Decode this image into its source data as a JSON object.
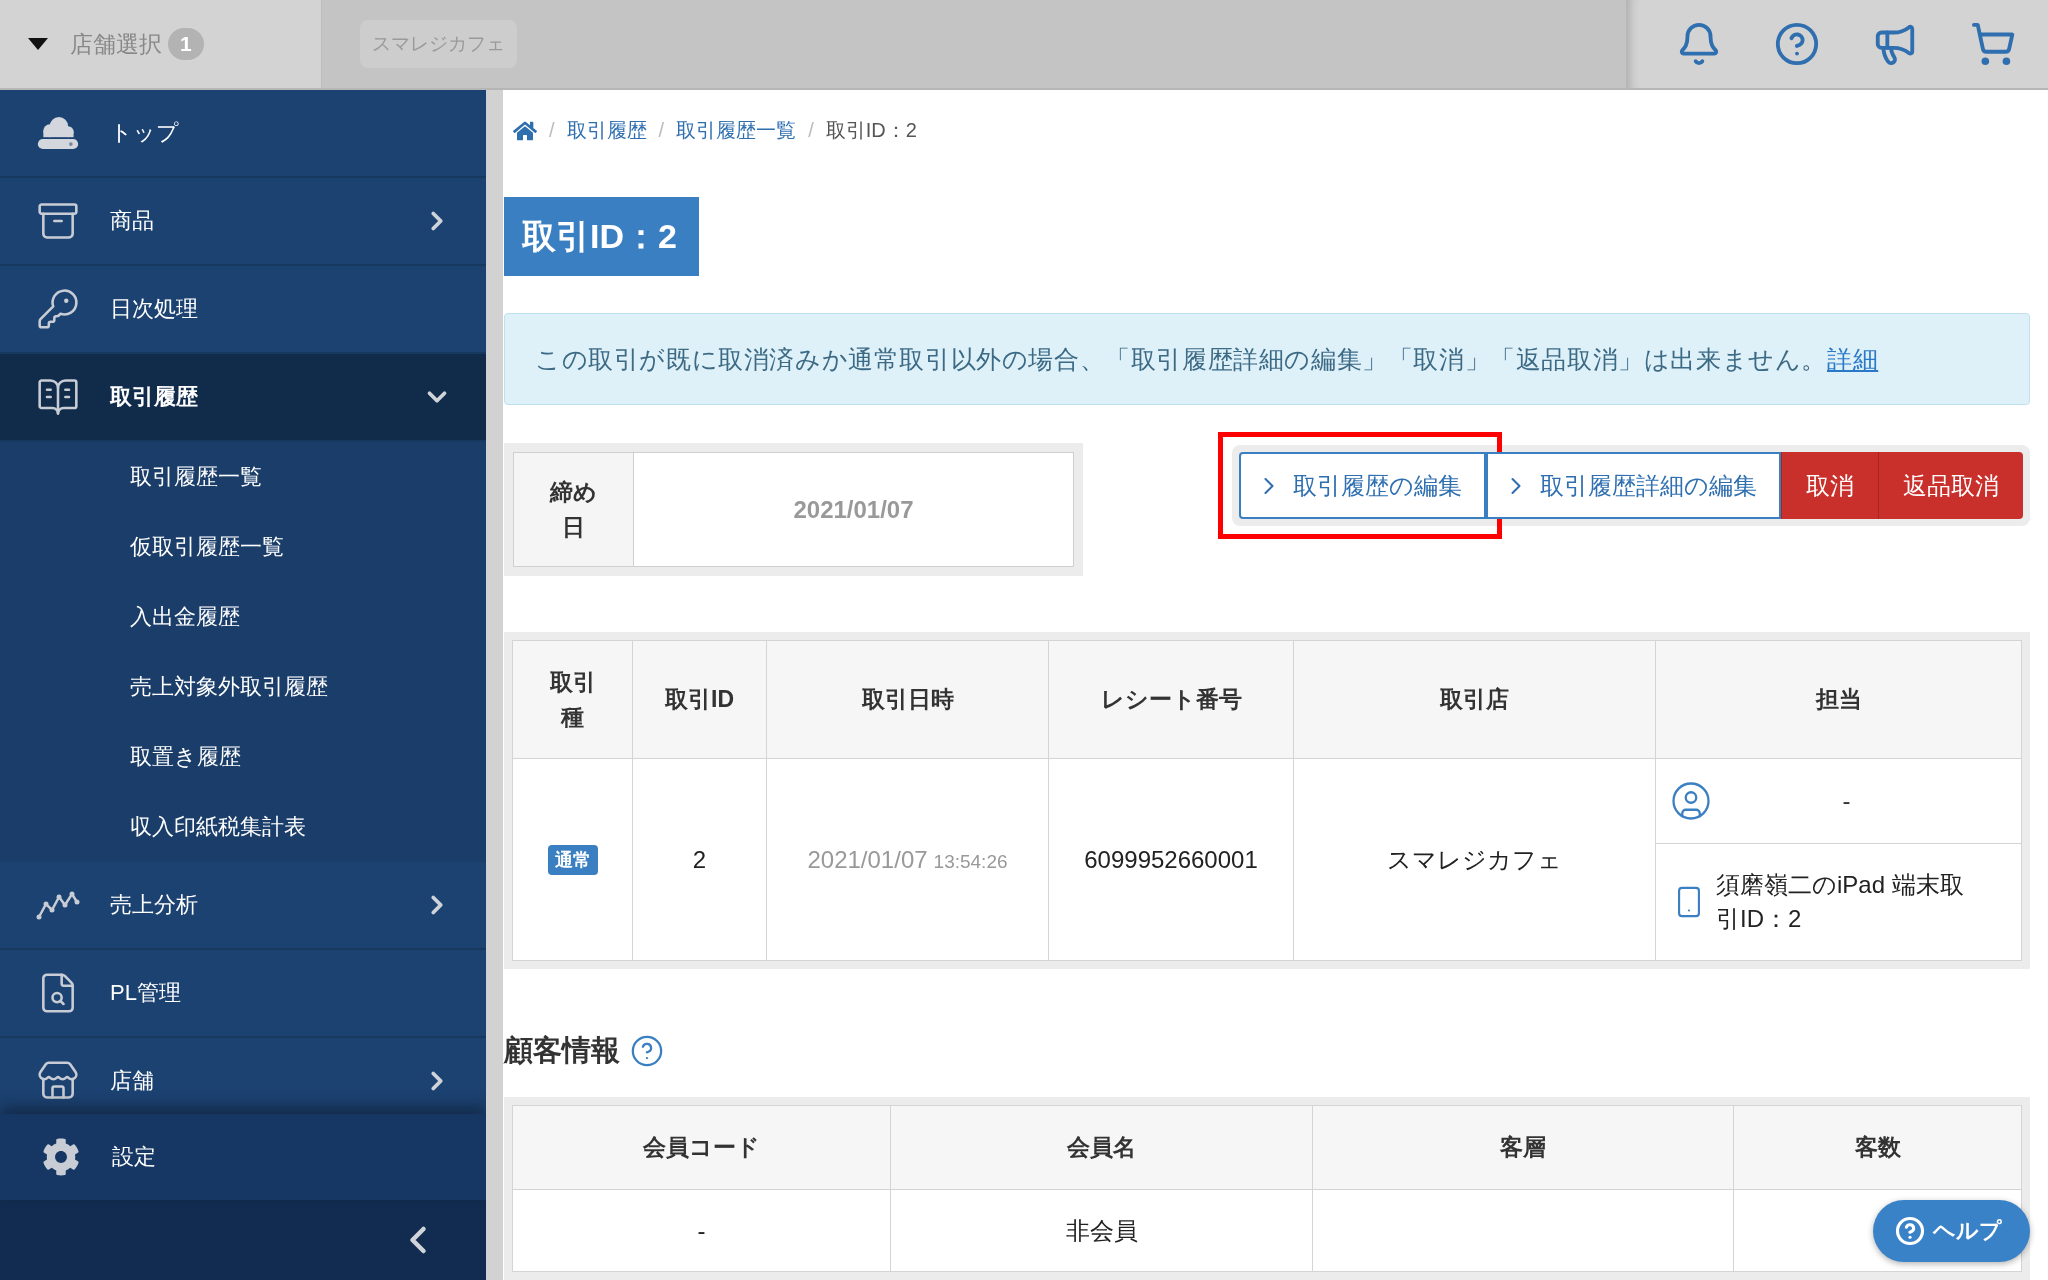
{
  "top_bar": {
    "store_selector": {
      "label": "店舗選択",
      "count": "1"
    },
    "store_chip": "スマレジカフェ"
  },
  "sidebar": {
    "items": [
      {
        "label": "トップ",
        "kind": "link",
        "selected": false
      },
      {
        "label": "商品",
        "kind": "menu",
        "selected": false,
        "expanded": false
      },
      {
        "label": "日次処理",
        "kind": "link",
        "selected": false
      },
      {
        "label": "取引履歴",
        "kind": "menu",
        "selected": true,
        "expanded": true,
        "children": [
          {
            "label": "取引履歴一覧",
            "selected": false
          },
          {
            "label": "仮取引履歴一覧",
            "selected": false
          },
          {
            "label": "入出金履歴",
            "selected": false
          },
          {
            "label": "売上対象外取引履歴",
            "selected": false
          },
          {
            "label": "取置き履歴",
            "selected": false
          },
          {
            "label": "収入印紙税集計表",
            "selected": false
          }
        ]
      },
      {
        "label": "売上分析",
        "kind": "menu",
        "selected": false,
        "expanded": false
      },
      {
        "label": "PL管理",
        "kind": "link",
        "selected": false
      },
      {
        "label": "店舗",
        "kind": "menu",
        "selected": false,
        "expanded": false
      }
    ],
    "footer_item": {
      "label": "設定"
    }
  },
  "breadcrumb": {
    "separator": "/",
    "items": [
      {
        "label": "取引履歴",
        "kind": "link"
      },
      {
        "label": "取引履歴一覧",
        "kind": "link"
      },
      {
        "label": "取引ID：2",
        "kind": "current"
      }
    ]
  },
  "page_title": "取引ID：2",
  "notice": {
    "text": "この取引が既に取消済みか通常取引以外の場合、「取引履歴詳細の編集」「取消」「返品取消」は出来ません。",
    "link": "詳細"
  },
  "closing_date": {
    "label": "締め日",
    "value": "2021/01/07"
  },
  "actions": [
    {
      "label": "取引履歴の編集",
      "kind": "outline",
      "highlighted": true
    },
    {
      "label": "取引履歴詳細の編集",
      "kind": "outline",
      "highlighted": false
    },
    {
      "label": "取消",
      "kind": "danger",
      "highlighted": false
    },
    {
      "label": "返品取消",
      "kind": "danger",
      "highlighted": false
    }
  ],
  "transaction_table": {
    "columns": [
      "取引種",
      "取引ID",
      "取引日時",
      "レシート番号",
      "取引店",
      "担当"
    ],
    "rows": [
      {
        "type": "通常",
        "id": "2",
        "date": "2021/01/07",
        "time": "13:54:26",
        "receipt_number": "6099952660001",
        "store": "スマレジカフェ",
        "staff": "-",
        "terminal": "須磨嶺二のiPad 端末取引ID：2"
      }
    ]
  },
  "customer_info": {
    "title": "顧客情報",
    "columns": [
      "会員コード",
      "会員名",
      "客層",
      "客数"
    ],
    "rows": [
      {
        "member_code": "-",
        "member_name": "非会員"
      }
    ]
  },
  "help_button": {
    "label": "ヘルプ"
  }
}
